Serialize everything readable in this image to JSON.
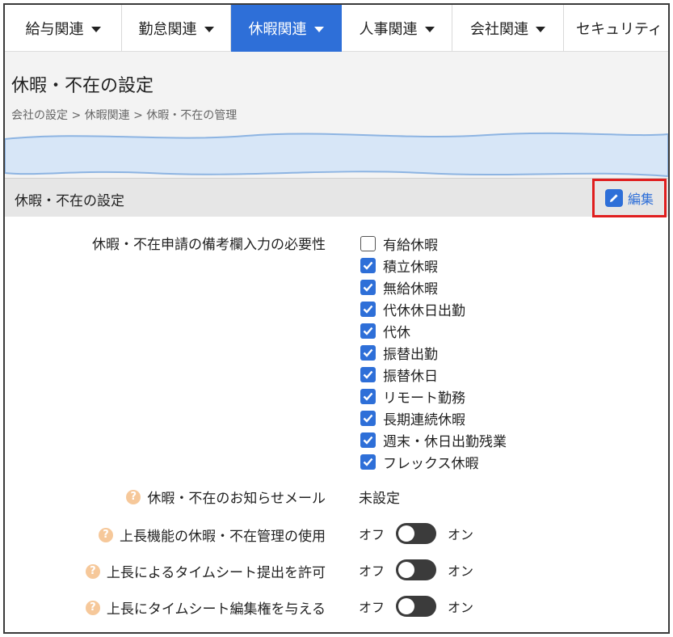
{
  "nav": {
    "items": [
      {
        "label": "給与関連",
        "active": false
      },
      {
        "label": "勤怠関連",
        "active": false
      },
      {
        "label": "休暇関連",
        "active": true
      },
      {
        "label": "人事関連",
        "active": false
      },
      {
        "label": "会社関連",
        "active": false
      },
      {
        "label": "セキュリティ",
        "active": false
      }
    ]
  },
  "header": {
    "title": "休暇・不在の設定",
    "breadcrumb": "会社の設定 > 休暇関連 > 休暇・不在の管理"
  },
  "section": {
    "title": "休暇・不在の設定",
    "edit_label": "編集"
  },
  "settings": {
    "remarks_required": {
      "label": "休暇・不在申請の備考欄入力の必要性",
      "options": [
        {
          "label": "有給休暇",
          "checked": false
        },
        {
          "label": "積立休暇",
          "checked": true
        },
        {
          "label": "無給休暇",
          "checked": true
        },
        {
          "label": "代休休日出勤",
          "checked": true
        },
        {
          "label": "代休",
          "checked": true
        },
        {
          "label": "振替出勤",
          "checked": true
        },
        {
          "label": "振替休日",
          "checked": true
        },
        {
          "label": "リモート勤務",
          "checked": true
        },
        {
          "label": "長期連続休暇",
          "checked": true
        },
        {
          "label": "週末・休日出勤残業",
          "checked": true
        },
        {
          "label": "フレックス休暇",
          "checked": true
        }
      ]
    },
    "notify_mail": {
      "label": "休暇・不在のお知らせメール",
      "value": "未設定"
    },
    "toggles": [
      {
        "label": "上長機能の休暇・不在管理の使用",
        "off": "オフ",
        "on": "オン",
        "state": "off"
      },
      {
        "label": "上長によるタイムシート提出を許可",
        "off": "オフ",
        "on": "オン",
        "state": "off"
      },
      {
        "label": "上長にタイムシート編集権を与える",
        "off": "オフ",
        "on": "オン",
        "state": "off"
      }
    ],
    "help_glyph": "?"
  },
  "colors": {
    "accent": "#2e6fd8",
    "highlight": "#e01e1e",
    "help": "#f6c89a"
  }
}
